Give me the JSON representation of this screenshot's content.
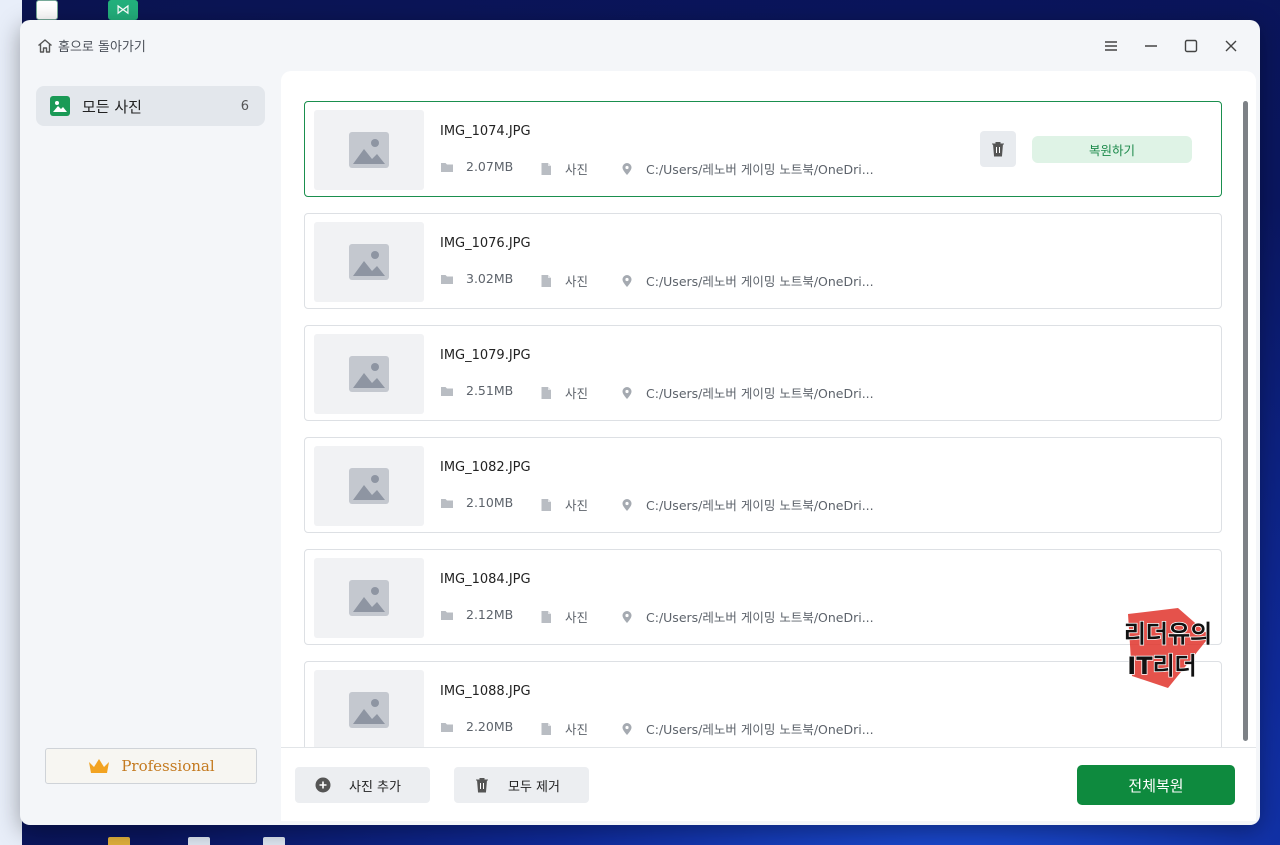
{
  "titlebar": {
    "home_label": "홈으로 돌아가기",
    "home_icon": "home-icon",
    "controls": [
      "menu-icon",
      "minimize-icon",
      "maximize-icon",
      "close-icon"
    ]
  },
  "sidebar": {
    "items": [
      {
        "label": "모든 사진",
        "count": "6",
        "icon": "photo-icon"
      }
    ],
    "professional_label": "Professional"
  },
  "files": [
    {
      "name": "IMG_1074.JPG",
      "size": "2.07MB",
      "type": "사진",
      "path": "C:/Users/레노버 게이밍 노트북/OneDri...",
      "selected": true
    },
    {
      "name": "IMG_1076.JPG",
      "size": "3.02MB",
      "type": "사진",
      "path": "C:/Users/레노버 게이밍 노트북/OneDri..."
    },
    {
      "name": "IMG_1079.JPG",
      "size": "2.51MB",
      "type": "사진",
      "path": "C:/Users/레노버 게이밍 노트북/OneDri..."
    },
    {
      "name": "IMG_1082.JPG",
      "size": "2.10MB",
      "type": "사진",
      "path": "C:/Users/레노버 게이밍 노트북/OneDri..."
    },
    {
      "name": "IMG_1084.JPG",
      "size": "2.12MB",
      "type": "사진",
      "path": "C:/Users/레노버 게이밍 노트북/OneDri..."
    },
    {
      "name": "IMG_1088.JPG",
      "size": "2.20MB",
      "type": "사진",
      "path": "C:/Users/레노버 게이밍 노트북/OneDri..."
    }
  ],
  "row_actions": {
    "recover_label": "복원하기"
  },
  "footer": {
    "add_label": "사진 추가",
    "clear_label": "모두 제거",
    "recover_all_label": "전체복원"
  },
  "watermark": {
    "line1": "리더유의",
    "line2": "IT리더"
  },
  "colors": {
    "accent": "#0e8a3e",
    "accent_light": "#dff3e6",
    "selected_border": "#1a8f4e"
  }
}
